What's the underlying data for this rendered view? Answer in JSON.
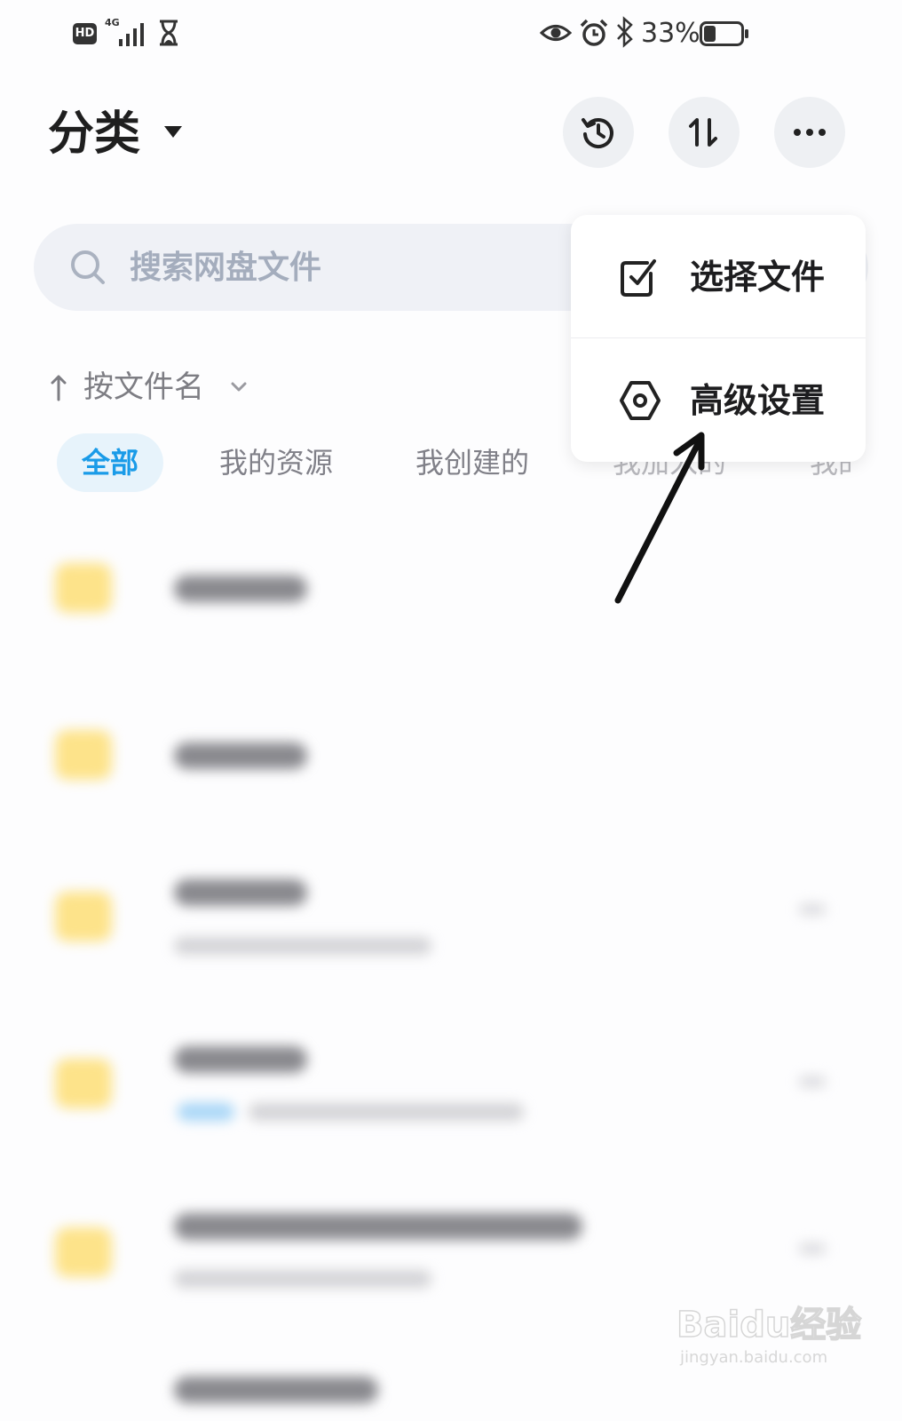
{
  "status_bar": {
    "hd_badge": "HD",
    "network_type": "4G",
    "battery_percent": "33%",
    "battery_level": 0.33
  },
  "header": {
    "title": "分类"
  },
  "search": {
    "placeholder": "搜索网盘文件"
  },
  "sort": {
    "label": "按文件名"
  },
  "tabs": [
    {
      "label": "全部",
      "active": true
    },
    {
      "label": "我的资源",
      "active": false
    },
    {
      "label": "我创建的",
      "active": false
    },
    {
      "label": "我加入的",
      "active": false
    },
    {
      "label": "我的",
      "active": false
    }
  ],
  "popup_menu": {
    "items": [
      {
        "label": "选择文件",
        "icon": "checkbox-icon"
      },
      {
        "label": "高级设置",
        "icon": "settings-hex-icon"
      }
    ]
  },
  "watermark": {
    "brand": "Baidu经验",
    "url": "jingyan.baidu.com"
  },
  "colors": {
    "accent": "#1a9be8",
    "active_tab_bg": "#e7f3fb",
    "folder": "#fde38a",
    "search_bg": "#eff1f6"
  }
}
